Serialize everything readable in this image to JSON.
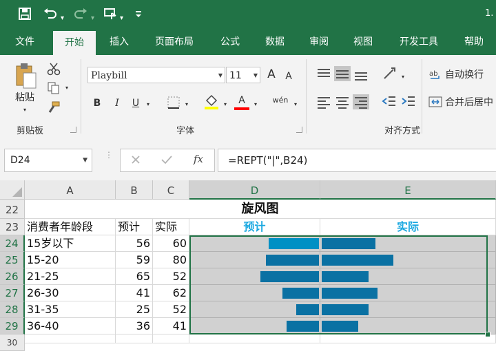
{
  "qat": {
    "save_icon": "save-icon",
    "undo_icon": "undo-icon",
    "redo_icon": "redo-icon",
    "touch_icon": "touch-mode-icon",
    "customize_icon": "customize-icon"
  },
  "app_title": "1.",
  "tabs": [
    "文件",
    "开始",
    "插入",
    "页面布局",
    "公式",
    "数据",
    "审阅",
    "视图",
    "开发工具",
    "帮助"
  ],
  "ribbon": {
    "clipboard": {
      "paste_label": "粘贴",
      "group_label": "剪贴板"
    },
    "font": {
      "name": "Playbill",
      "size": "11",
      "group_label": "字体",
      "bold": "B",
      "italic": "I",
      "underline": "U",
      "grow": "A",
      "shrink": "A",
      "font_color_letter": "A",
      "phonetic": "wén",
      "fill_color": "#ffff00",
      "font_color": "#ff0000"
    },
    "alignment": {
      "wrap_text": "自动换行",
      "merge_center": "合并后居中",
      "group_label": "对齐方式"
    }
  },
  "formula_bar": {
    "name_box": "D24",
    "formula": "=REPT(\"|\",B24)",
    "fx": "fx"
  },
  "sheet": {
    "columns": [
      "A",
      "B",
      "C",
      "D",
      "E"
    ],
    "rows": [
      "22",
      "23",
      "24",
      "25",
      "26",
      "27",
      "28",
      "29",
      "30"
    ],
    "title": "旋风图",
    "headers": {
      "a": "消费者年龄段",
      "b": "预计",
      "c": "实际",
      "d": "预计",
      "e": "实际"
    },
    "data": [
      {
        "age": "15岁以下",
        "plan": 56,
        "actual": 60
      },
      {
        "age": "15-20",
        "plan": 59,
        "actual": 80
      },
      {
        "age": "21-25",
        "plan": 65,
        "actual": 52
      },
      {
        "age": "26-30",
        "plan": 41,
        "actual": 62
      },
      {
        "age": "31-35",
        "plan": 25,
        "actual": 52
      },
      {
        "age": "36-40",
        "plan": 36,
        "actual": 41
      }
    ],
    "bar_color": "#0d8ac7",
    "selected_bar_color": "#00b0f0",
    "selection_color": "#217346"
  }
}
